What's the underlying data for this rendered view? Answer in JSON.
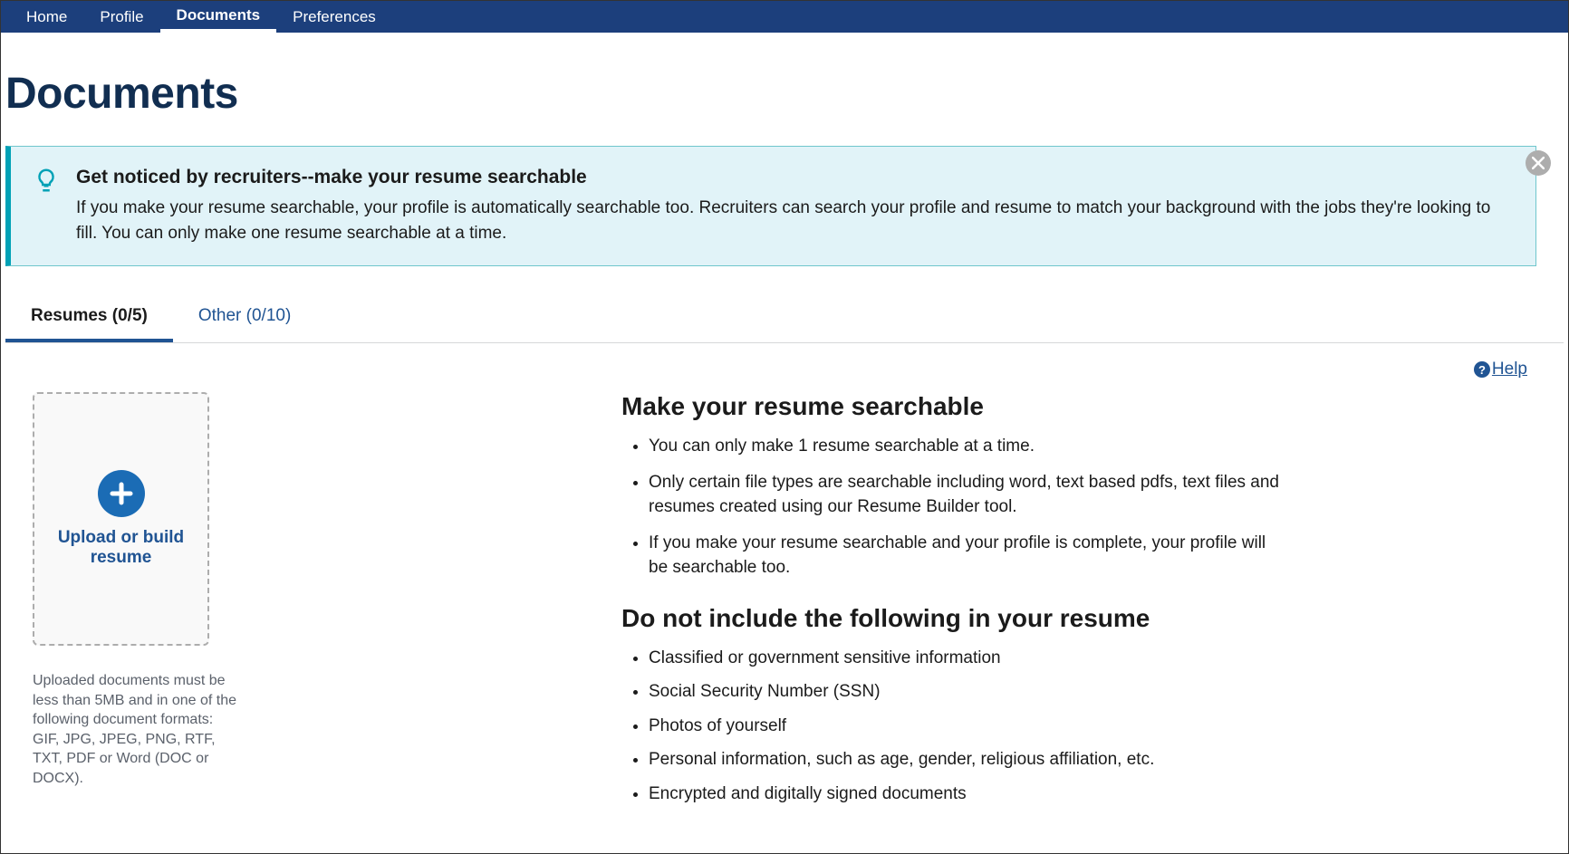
{
  "nav": {
    "home": "Home",
    "profile": "Profile",
    "documents": "Documents",
    "preferences": "Preferences"
  },
  "page_title": "Documents",
  "tip": {
    "title": "Get noticed by recruiters--make your resume searchable",
    "body": "If you make your resume searchable, your profile is automatically searchable too. Recruiters can search your profile and resume to match your background with the jobs they're looking to fill. You can only make one resume searchable at a time."
  },
  "tabs": {
    "resumes": "Resumes (0/5)",
    "other": "Other (0/10)"
  },
  "help_label": "Help",
  "upload": {
    "label": "Upload or build resume",
    "note": "Uploaded documents must be less than 5MB and in one of the following document formats: GIF, JPG, JPEG, PNG, RTF, TXT, PDF or Word (DOC or DOCX)."
  },
  "info": {
    "heading1": "Make your resume searchable",
    "list1": [
      "You can only make 1 resume searchable at a time.",
      "Only certain file types are searchable including word, text based pdfs, text files and resumes created using our Resume Builder tool.",
      "If you make your resume searchable and your profile is complete, your profile will be searchable too."
    ],
    "heading2": "Do not include the following in your resume",
    "list2": [
      "Classified or government sensitive information",
      "Social Security Number (SSN)",
      "Photos of yourself",
      "Personal information, such as age, gender, religious affiliation, etc.",
      "Encrypted and digitally signed documents"
    ]
  }
}
